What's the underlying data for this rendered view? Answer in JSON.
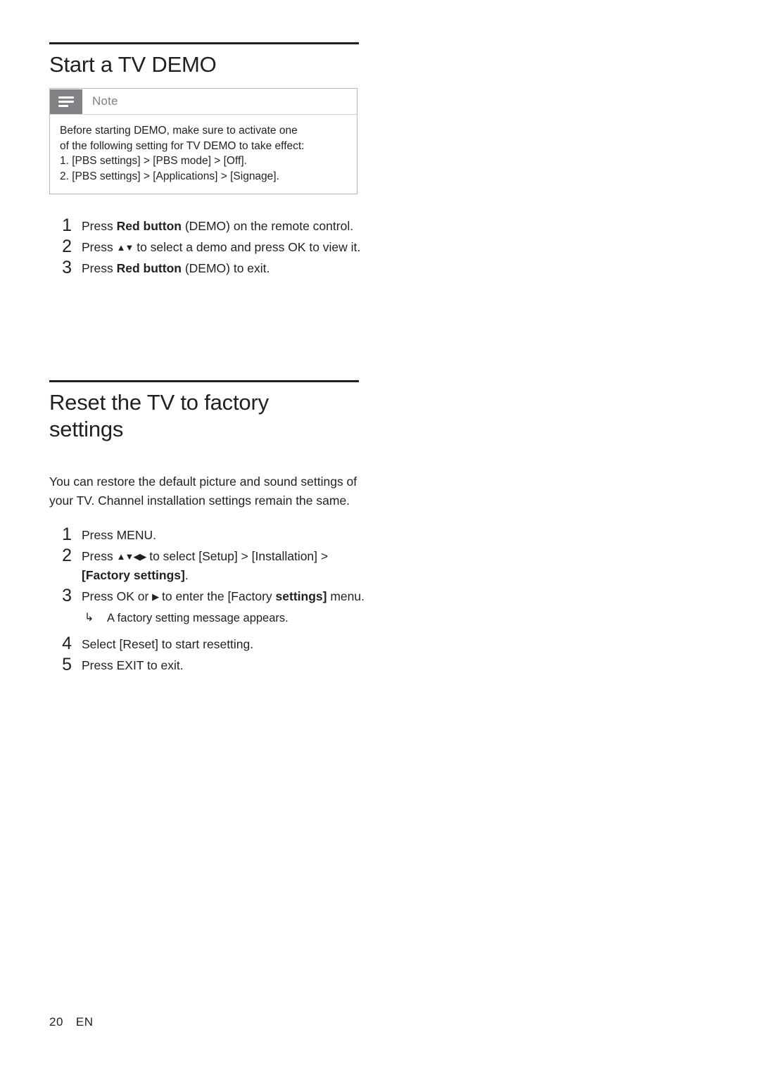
{
  "sections": [
    {
      "id": "start-demo",
      "title": "Start a TV DEMO",
      "note": {
        "label": "Note",
        "icon": "note-lines-icon",
        "lines": [
          "Before starting DEMO, make sure to activate one",
          "of the following setting for TV DEMO to take effect:",
          "1. [PBS settings] > [PBS mode] > [Off].",
          "2. [PBS settings] > [Applications] > [Signage]."
        ]
      },
      "steps": [
        {
          "num": "1",
          "text_parts": [
            {
              "t": "Press ",
              "bold": false
            },
            {
              "t": "Red button",
              "bold": true
            },
            {
              "t": " (DEMO) on the remote control.",
              "bold": false
            }
          ]
        },
        {
          "num": "2",
          "text_parts": [
            {
              "t": "Press ",
              "bold": false
            },
            {
              "t": "▲▼",
              "bold": false
            },
            {
              "t": " to select a demo and press ",
              "bold": false
            },
            {
              "t": "OK",
              "bold": false
            },
            {
              "t": " to view it.",
              "bold": false
            }
          ]
        },
        {
          "num": "3",
          "text_parts": [
            {
              "t": "Press ",
              "bold": false
            },
            {
              "t": "Red button",
              "bold": true
            },
            {
              "t": " (DEMO) to exit.",
              "bold": false
            }
          ]
        }
      ]
    },
    {
      "id": "factory-reset",
      "title": "Reset the TV to factory settings",
      "intro": "You can restore the default picture and sound settings of your TV. Channel installation settings remain the same.",
      "steps": [
        {
          "num": "1",
          "text": "Press MENU."
        },
        {
          "num": "2",
          "text": "Press ▲▼◀▶ to select [Setup] > [Installation] > [Factory settings]."
        },
        {
          "num": "3",
          "text": "Press OK or ▶ to enter the [Factory settings] menu.",
          "subtext": "A factory setting message appears.",
          "sub_arrow": "↳"
        },
        {
          "num": "4",
          "text": "Select [Reset] to start resetting."
        },
        {
          "num": "5",
          "text": "Press EXIT to exit."
        }
      ]
    }
  ],
  "footer": {
    "page_number": "20",
    "language": "EN"
  }
}
